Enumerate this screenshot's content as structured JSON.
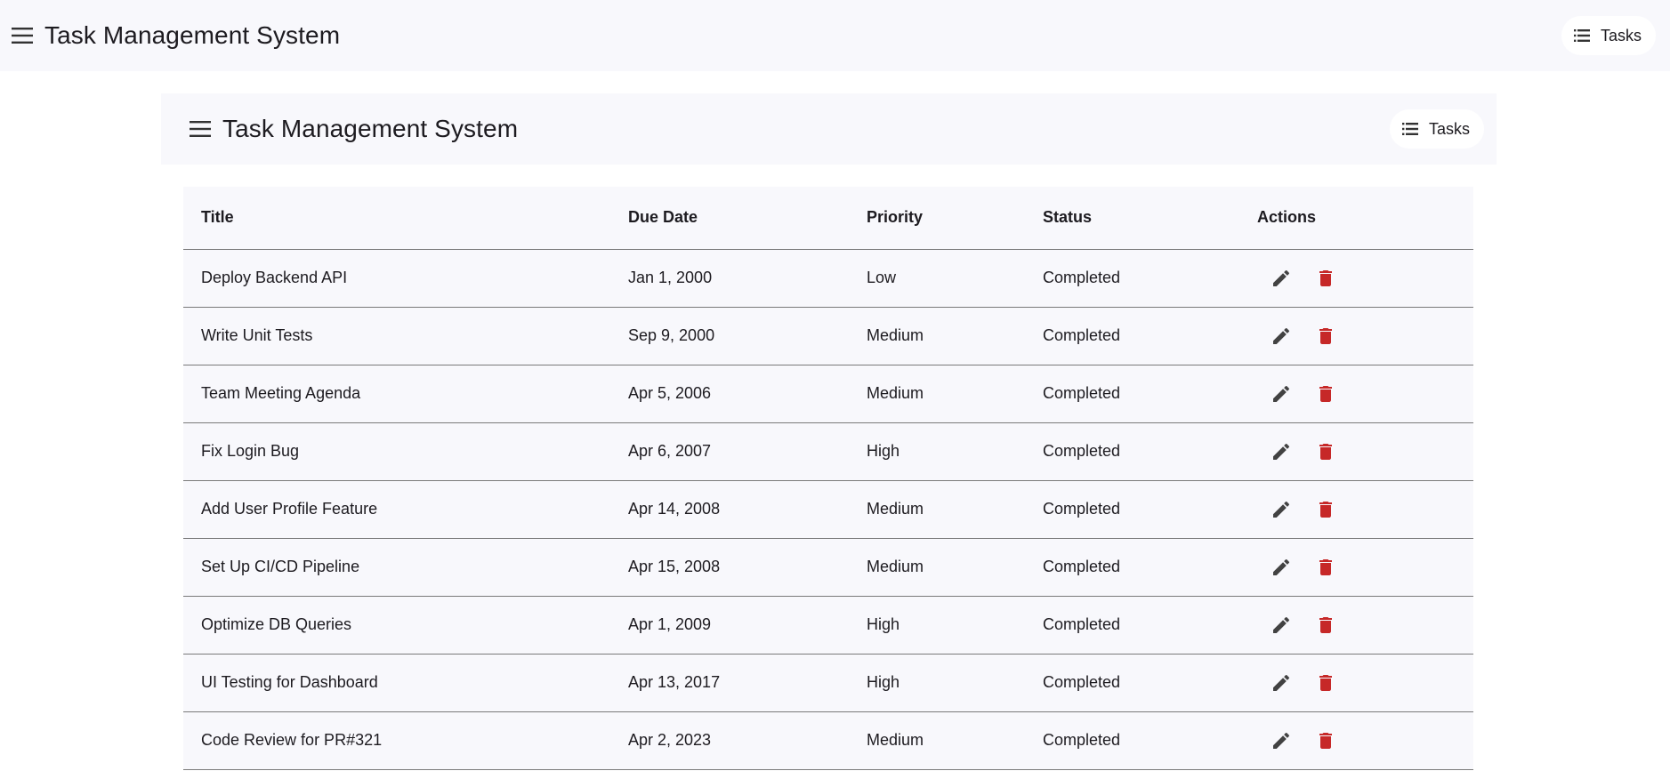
{
  "app_bar": {
    "title": "Task Management System",
    "nav_label": "Tasks"
  },
  "card_toolbar": {
    "title": "Task Management System",
    "nav_label": "Tasks"
  },
  "icons": {
    "menu": "menu-icon",
    "list": "list-icon",
    "edit": "edit-icon",
    "delete": "delete-icon"
  },
  "colors": {
    "delete": "#c62828",
    "edit": "#424242",
    "surface": "#f8f8fc"
  },
  "table": {
    "headers": [
      "Title",
      "Due Date",
      "Priority",
      "Status",
      "Actions"
    ],
    "rows": [
      {
        "title": "Deploy Backend API",
        "due": "Jan 1, 2000",
        "priority": "Low",
        "status": "Completed"
      },
      {
        "title": "Write Unit Tests",
        "due": "Sep 9, 2000",
        "priority": "Medium",
        "status": "Completed"
      },
      {
        "title": "Team Meeting Agenda",
        "due": "Apr 5, 2006",
        "priority": "Medium",
        "status": "Completed"
      },
      {
        "title": "Fix Login Bug",
        "due": "Apr 6, 2007",
        "priority": "High",
        "status": "Completed"
      },
      {
        "title": "Add User Profile Feature",
        "due": "Apr 14, 2008",
        "priority": "Medium",
        "status": "Completed"
      },
      {
        "title": "Set Up CI/CD Pipeline",
        "due": "Apr 15, 2008",
        "priority": "Medium",
        "status": "Completed"
      },
      {
        "title": "Optimize DB Queries",
        "due": "Apr 1, 2009",
        "priority": "High",
        "status": "Completed"
      },
      {
        "title": "UI Testing for Dashboard",
        "due": "Apr 13, 2017",
        "priority": "High",
        "status": "Completed"
      },
      {
        "title": "Code Review for PR#321",
        "due": "Apr 2, 2023",
        "priority": "Medium",
        "status": "Completed"
      }
    ]
  }
}
